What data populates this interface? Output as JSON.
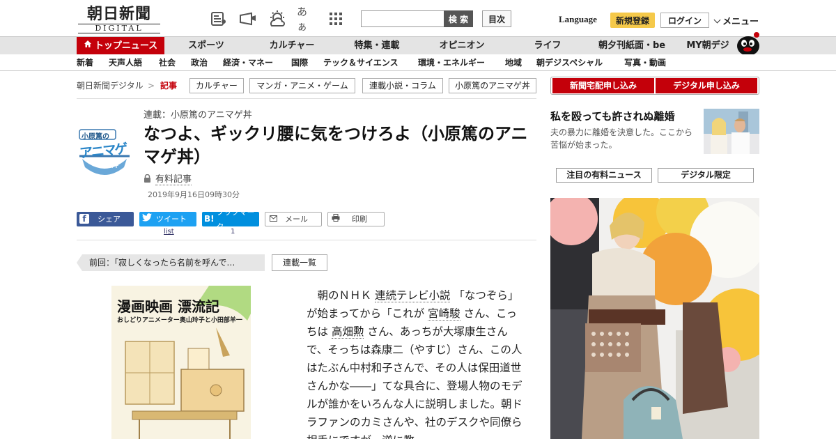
{
  "header": {
    "logo_jp": "朝日新聞",
    "logo_en": "DIGITAL",
    "icons": [
      "newspaper-icon",
      "megaphone-icon",
      "weather-icon",
      "text-size-icon",
      "apps-grid-icon"
    ],
    "text_size_label": "あぁ",
    "search_placeholder": "",
    "search_button": "検 索",
    "toc_button": "目次",
    "language": "Language",
    "register": "新規登録",
    "login": "ログイン",
    "menu": "メニュー"
  },
  "nav_primary": [
    "トップニュース",
    "スポーツ",
    "カルチャー",
    "特集・連載",
    "オピニオン",
    "ライフ",
    "朝夕刊紙面・be",
    "MY朝デジ"
  ],
  "nav_secondary": [
    "新着",
    "天声人語",
    "社会",
    "政治",
    "経済・マネー",
    "国際",
    "テック＆サイエンス",
    "環境・エネルギー",
    "地域",
    "朝デジスペシャル",
    "写真・動画"
  ],
  "breadcrumb": {
    "home": "朝日新聞デジタル",
    "sep": ">",
    "current": "記事",
    "tags": [
      "カルチャー",
      "マンガ・アニメ・ゲーム",
      "連載小説・コラム",
      "小原篤のアニマゲ丼"
    ]
  },
  "subscribe": {
    "paper": "新聞宅配申し込み",
    "digital": "デジタル申し込み"
  },
  "article": {
    "series_thumb_text": "小原篤の",
    "series_thumb_big": "アニマゲ",
    "series_thumb_bowl": "丼",
    "series_label": "連載：小原篤のアニマゲ丼",
    "title": "なつよ、ギックリ腰に気をつけろよ（小原篤のアニマゲ丼）",
    "paid_label": "有料記事",
    "date": "2019年9月16日09時30分",
    "share": {
      "facebook": "シェア",
      "twitter": "ツイート",
      "twitter_count": "list",
      "hatena": "ブックマーク",
      "hatena_count": "1",
      "mail": "メール",
      "print": "印刷"
    },
    "prev_label": "前回：「寂しくなったら名前を呼んで…",
    "series_list": "連載一覧",
    "book": {
      "title": "漫画映画 漂流記",
      "subtitle": "おしどりアニメーター奥山玲子と小田部羊一"
    },
    "body": {
      "p1": "朝のＮＨＫ",
      "link1": "連続テレビ小説",
      "p2": "「なつぞら」が始まってから「これが",
      "link2": "宮崎駿",
      "p3": "さん、こっちは",
      "link3": "高畑勲",
      "p4": "さん、あっちが大塚康生さんで、そっちは森康二（やすじ）さん、この人はたぶん中村和子さんで、その人は保田道世さんかな――」てな具合に、登場人物のモデルが誰かをいろんな人に説明しました。朝ドラファンのカミさんや、社のデスクや同僚ら相手にですが、逆に教"
    }
  },
  "sidebar": {
    "headline": "私を殴っても許されぬ離婚",
    "description": "夫の暴力に離婚を決意した。ここから苦悩が始まった。",
    "tab1": "注目の有料ニュース",
    "tab2": "デジタル限定"
  },
  "colors": {
    "brand_red": "#c4000a",
    "register_yellow": "#f5c94a",
    "facebook": "#3b5998",
    "twitter": "#1da1f2",
    "hatena": "#008fde"
  }
}
